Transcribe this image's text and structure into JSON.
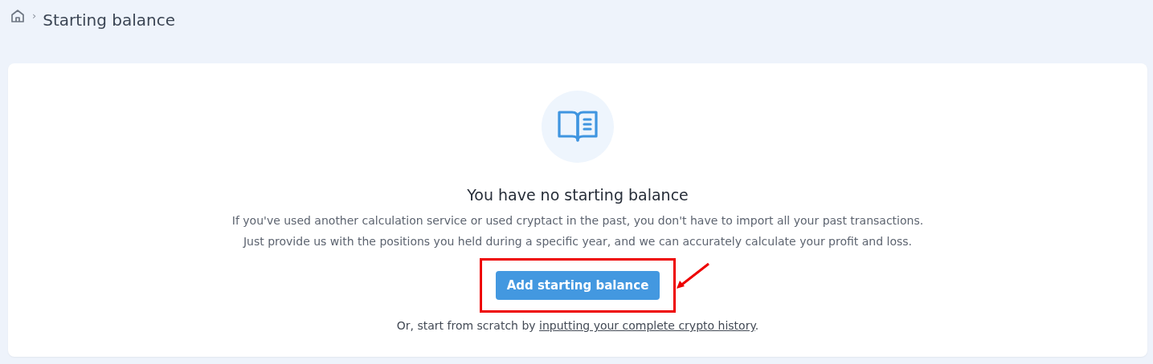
{
  "breadcrumb": {
    "separator": "›",
    "current": "Starting balance"
  },
  "empty_state": {
    "title": "You have no starting balance",
    "lines": [
      "If you've used another calculation service or used cryptact in the past, you don't have to import all your past transactions.",
      "Just provide us with the positions you held during a specific year, and we can accurately calculate your profit and loss."
    ],
    "button": {
      "label": "Add starting balance",
      "highlighted": true
    },
    "footer": {
      "before": "Or, start from scratch by ",
      "link": "inputting your complete crypto history",
      "after": "."
    }
  }
}
